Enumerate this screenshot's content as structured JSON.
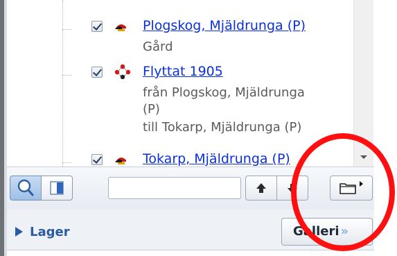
{
  "tree": {
    "items": [
      {
        "link": "Plogskog, Mjäldrunga (P)",
        "lines": [
          "Gård"
        ],
        "icon": "farm-icon"
      },
      {
        "link": "Flyttat 1905",
        "lines": [
          "från Plogskog, Mjäldrunga",
          "(P)",
          "till Tokarp, Mjäldrunga (P)"
        ],
        "icon": "move-event-icon"
      },
      {
        "link": "Tokarp, Mjäldrunga (P)",
        "lines": [],
        "icon": "farm-icon"
      }
    ]
  },
  "toolbar": {
    "search_value": "",
    "icons": [
      "search-icon",
      "legend-icon",
      "arrow-up-icon",
      "arrow-down-icon",
      "folder-icon"
    ]
  },
  "bottom": {
    "lager_label": "Lager",
    "galleri_label": "Galleri",
    "galleri_chevron": "»"
  },
  "colors": {
    "link": "#0a2fe0",
    "accent": "#2a5aa0",
    "annotation": "#ff1010"
  }
}
